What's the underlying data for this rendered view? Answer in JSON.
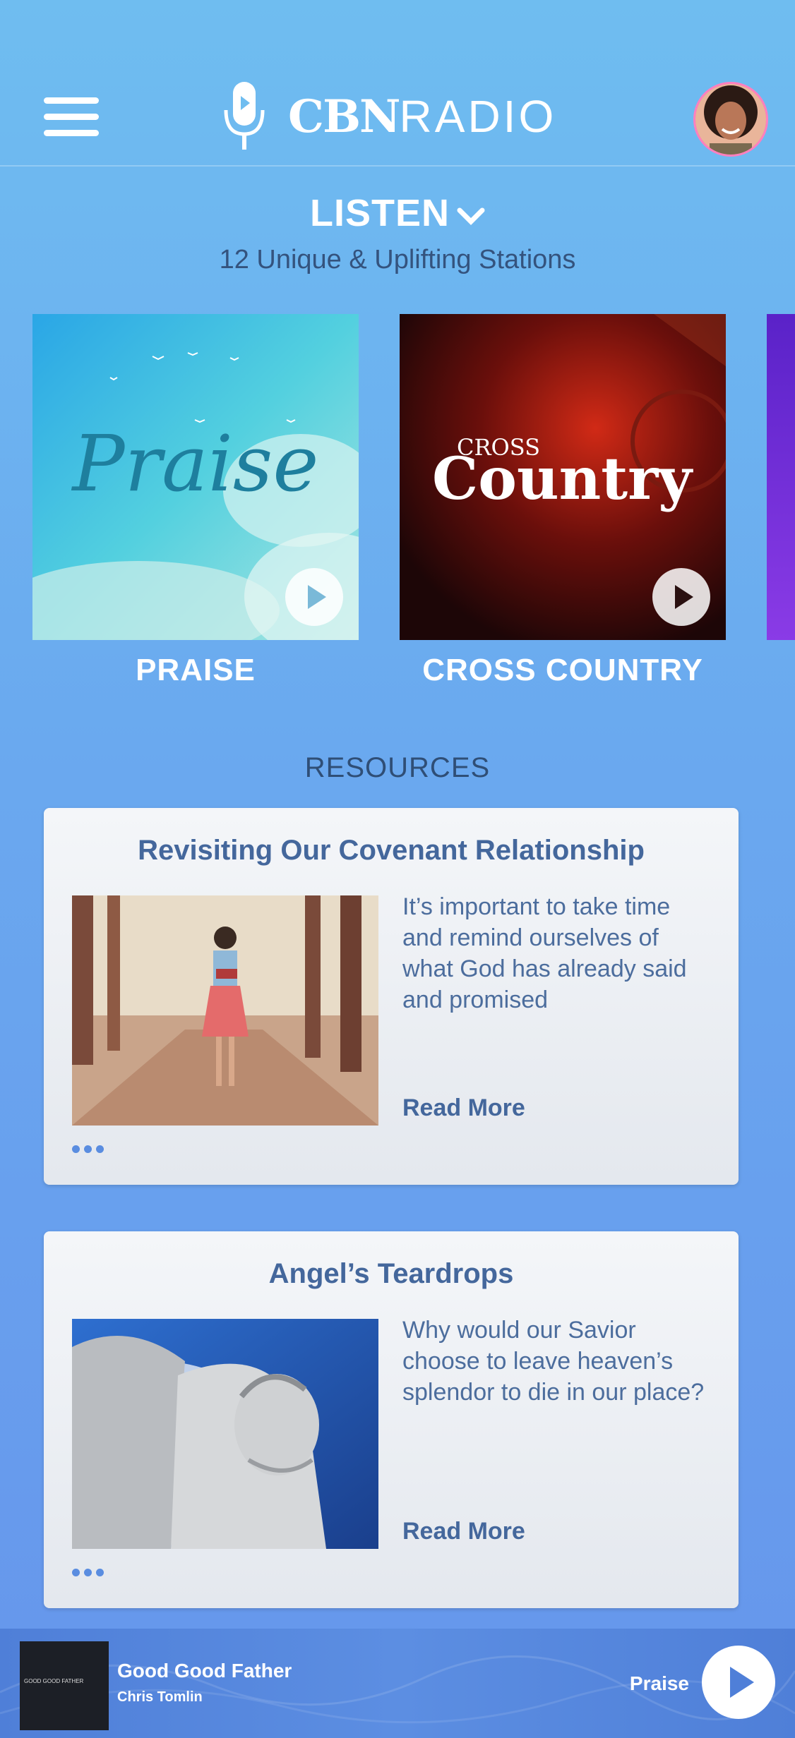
{
  "header": {
    "logo_bold": "CBN",
    "logo_light": "RADIO",
    "menu_icon": "hamburger-menu-icon",
    "mic_icon": "microphone-icon",
    "avatar_icon": "user-avatar"
  },
  "listen": {
    "title": "LISTEN",
    "subtitle": "12 Unique & Uplifting Stations",
    "dropdown_icon": "chevron-down-icon"
  },
  "stations": [
    {
      "label": "PRAISE",
      "art_text": "Praise"
    },
    {
      "label": "CROSS COUNTRY",
      "art_text_small": "CROSS",
      "art_text_large": "Country"
    }
  ],
  "resources": {
    "title": "RESOURCES",
    "cards": [
      {
        "title": "Revisiting Our Covenant Relationship",
        "description": "It’s important to take time and remind ourselves of what God has already said and promised",
        "read_more": "Read More"
      },
      {
        "title": "Angel’s Teardrops",
        "description": "Why would our Savior choose to leave heaven’s splendor to die in our place?",
        "read_more": "Read More"
      }
    ]
  },
  "player": {
    "album_art_text": "GOOD GOOD FATHER",
    "song": "Good Good Father",
    "artist": "Chris Tomlin",
    "station": "Praise",
    "play_icon": "play-icon"
  },
  "colors": {
    "background_top": "#6fbdf0",
    "background_bottom": "#6696ec",
    "card_title": "#44679c",
    "card_text": "#4c6d9d",
    "player_bar": "#4f7fd8"
  }
}
